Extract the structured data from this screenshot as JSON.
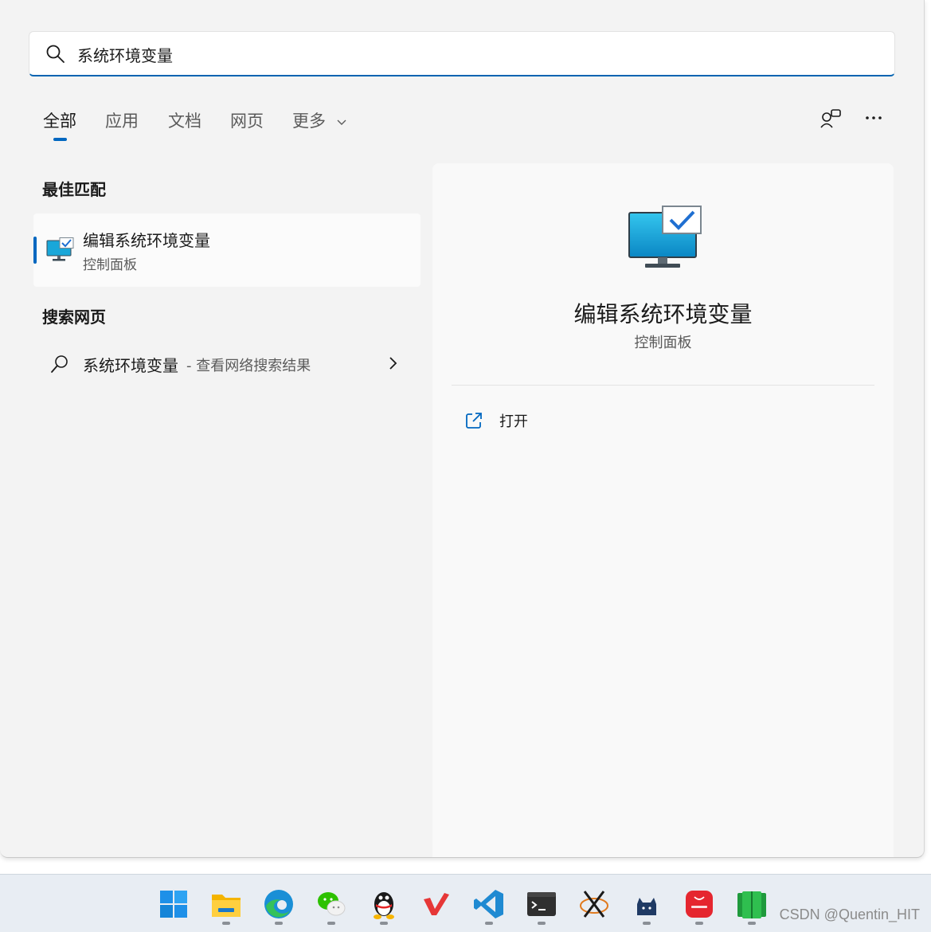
{
  "search": {
    "value": "系统环境变量"
  },
  "tabs": [
    {
      "label": "全部",
      "active": true
    },
    {
      "label": "应用"
    },
    {
      "label": "文档"
    },
    {
      "label": "网页"
    },
    {
      "label": "更多"
    }
  ],
  "best_match": {
    "heading": "最佳匹配",
    "title": "编辑系统环境变量",
    "subtitle": "控制面板",
    "icon": "system-properties-monitor-icon"
  },
  "web": {
    "heading": "搜索网页",
    "query": "系统环境变量",
    "hint": "- 查看网络搜索结果"
  },
  "detail": {
    "title": "编辑系统环境变量",
    "subtitle": "控制面板",
    "actions": [
      {
        "label": "打开",
        "icon": "open-external-icon"
      }
    ]
  },
  "taskbar": {
    "apps": [
      "start",
      "file-explorer",
      "edge",
      "wechat",
      "qq",
      "wps",
      "vscode",
      "terminal",
      "xmind",
      "github-desktop",
      "huawei-appgallery",
      "green-app"
    ]
  },
  "watermark": "CSDN @Quentin_HIT",
  "colors": {
    "accent": "#0067c0",
    "panel": "#f3f3f3",
    "taskbar": "#e8edf3"
  }
}
